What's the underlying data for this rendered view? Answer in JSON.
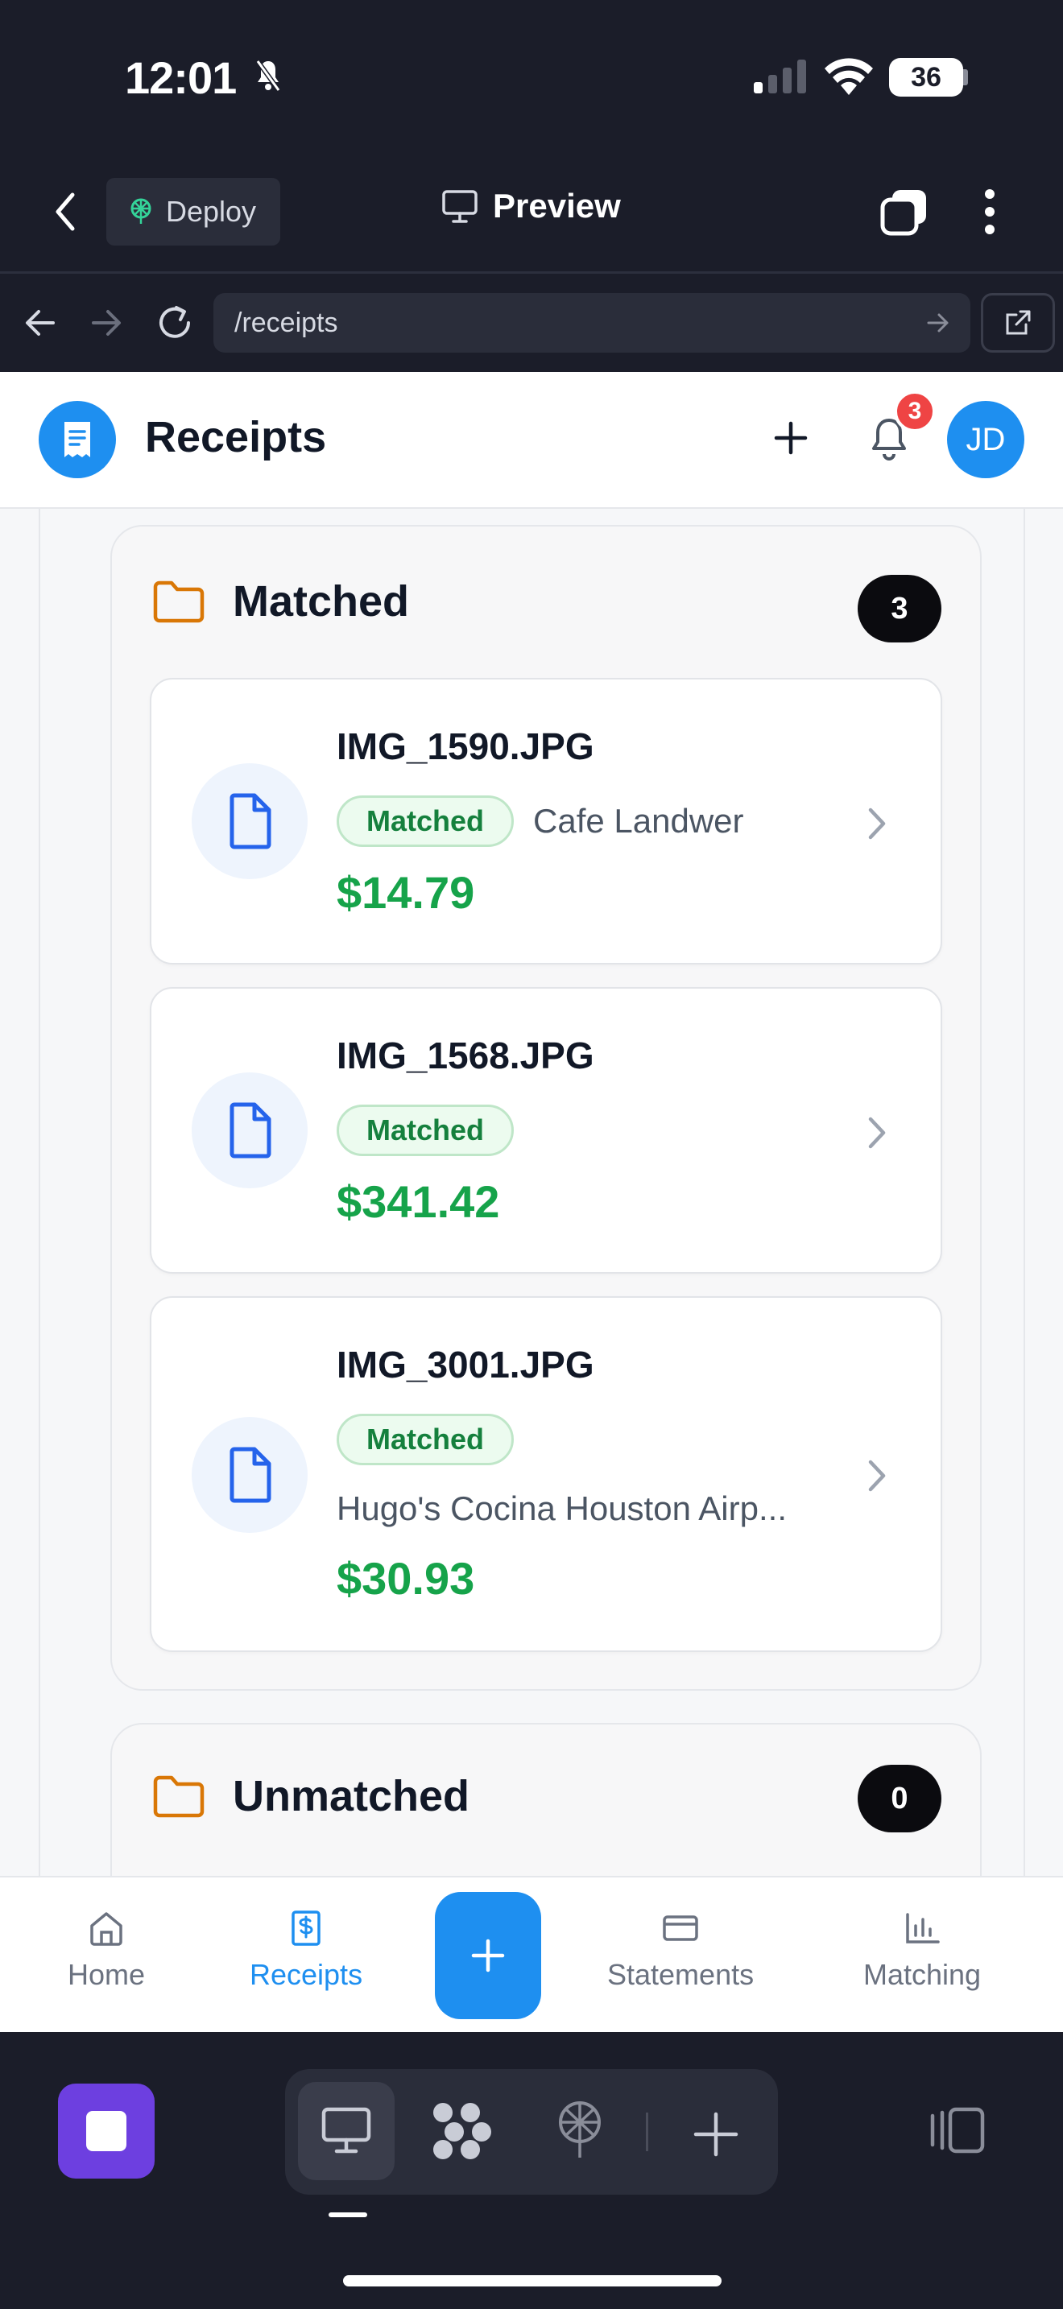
{
  "status_bar": {
    "time": "12:01",
    "battery": "36"
  },
  "app_header": {
    "deploy_label": "Deploy",
    "preview_label": "Preview"
  },
  "url_bar": {
    "url": "/receipts"
  },
  "page": {
    "title": "Receipts",
    "notification_count": "3",
    "avatar_initials": "JD"
  },
  "groups": {
    "matched": {
      "title": "Matched",
      "count": "3",
      "receipts": [
        {
          "filename": "IMG_1590.JPG",
          "status": "Matched",
          "merchant": "Cafe Landwer",
          "amount": "$14.79"
        },
        {
          "filename": "IMG_1568.JPG",
          "status": "Matched",
          "merchant": "",
          "amount": "$341.42"
        },
        {
          "filename": "IMG_3001.JPG",
          "status": "Matched",
          "merchant": "Hugo's Cocina Houston Airp...",
          "amount": "$30.93"
        }
      ]
    },
    "unmatched": {
      "title": "Unmatched",
      "count": "0"
    }
  },
  "tabs": {
    "home": "Home",
    "receipts": "Receipts",
    "statements": "Statements",
    "matching": "Matching"
  },
  "colors": {
    "accent": "#1e8ff0",
    "matched_green": "#16a34a",
    "folder_orange": "#d97706",
    "badge_red": "#ef4444"
  }
}
